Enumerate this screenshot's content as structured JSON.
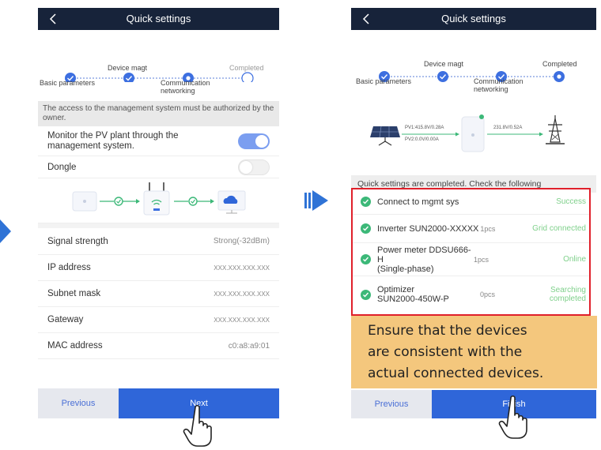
{
  "left_screen": {
    "title": "Quick settings",
    "steps": {
      "s1": "Basic parameters",
      "s2": "Device magt",
      "s3": "Communication",
      "s3b": "networking",
      "s4": "Completed"
    },
    "notice": "The access to the management system must be authorized by the owner.",
    "monitor_label": "Monitor the PV plant through the management system.",
    "dongle_label": "Dongle",
    "rows": [
      {
        "label": "Signal strength",
        "value": "Strong(-32dBm)"
      },
      {
        "label": "IP address",
        "value": "XXX.XXX.XXX.XXX"
      },
      {
        "label": "Subnet mask",
        "value": "XXX.XXX.XXX.XXX"
      },
      {
        "label": "Gateway",
        "value": "XXX.XXX.XXX.XXX"
      },
      {
        "label": "MAC address",
        "value": "c0:a8:a9:01"
      }
    ],
    "previous": "Previous",
    "next": "Next"
  },
  "right_screen": {
    "title": "Quick settings",
    "steps": {
      "s1": "Basic parameters",
      "s2": "Device magt",
      "s3": "Communication",
      "s3b": "networking",
      "s4": "Completed"
    },
    "pv1": "PV1:415.8V/0.28A",
    "pv2": "PV2:0.0V/0.00A",
    "grid": "231.8V/0.52A",
    "completed_note": "Quick settings are completed. Check the following",
    "items": [
      {
        "name": "Connect to mgmt sys",
        "count": "",
        "status": "Success"
      },
      {
        "name": "Inverter SUN2000-XXXXX",
        "count": "1pcs",
        "status": "Grid connected"
      },
      {
        "name": "Power meter DDSU666-H",
        "name2": "(Single-phase)",
        "count": "1pcs",
        "status": "Online"
      },
      {
        "name": "Optimizer",
        "name2": "SUN2000-450W-P",
        "count": "0pcs",
        "status": "Searching",
        "status2": "completed"
      }
    ],
    "previous": "Previous",
    "finish": "Finish"
  },
  "callout": {
    "line1": "Ensure that the devices",
    "line2": "are consistent with the",
    "line3": "actual connected devices."
  },
  "colors": {
    "header": "#17233a",
    "accent": "#2f66d9",
    "success": "#3cb878",
    "highlight_border": "#e0202b",
    "callout": "#f4c77d"
  }
}
